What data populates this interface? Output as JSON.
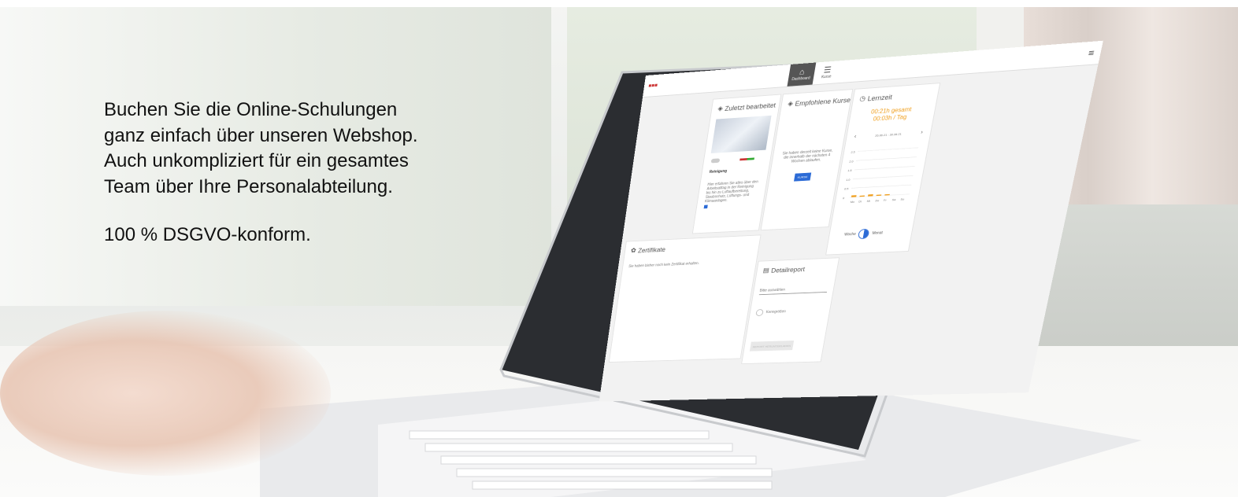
{
  "headline": {
    "lines": [
      "Buchen Sie die Online-Schulungen",
      "ganz einfach über unseren Webshop.",
      "Auch unkompliziert für ein gesamtes",
      "Team über Ihre Personalabteilung."
    ],
    "claim": "100 % DSGVO-konform."
  },
  "app": {
    "nav": [
      {
        "label": "Dashboard",
        "icon": "home-icon",
        "active": true
      },
      {
        "label": "Kurse",
        "icon": "courses-icon",
        "active": false
      }
    ],
    "menu_icon": "hamburger-icon",
    "recent": {
      "title": "Zuletzt bearbeitet",
      "course_name": "Reinigung",
      "description": "Hier erfahren Sie alles über den Arbeitsalltag in der Reinigung bis hin zu Luftaufbereitung, Staubschutz, Lüftungs- und Klimaanlagen."
    },
    "recommended": {
      "title": "Empfohlene Kurse",
      "message": "Sie haben derzeit keine Kurse, die innerhalb der nächsten 4 Wochen ablaufen.",
      "button": "KURSE"
    },
    "learning_time": {
      "title": "Lernzeit",
      "total": "00:21h gesamt",
      "per_day": "00:03h / Tag",
      "date_range": "26.06.21 - 30.06.21",
      "prev": "‹",
      "next": "›",
      "toggle_left": "Woche",
      "toggle_right": "Monat"
    },
    "certificates": {
      "title": "Zertifikate",
      "message": "Sie haben bisher noch kein Zertifikat erhalten."
    },
    "report": {
      "title": "Detailreport",
      "select_placeholder": "Bitte auswählen",
      "radio_label": "Kenngrößen",
      "button": "REPORT HERUNTERLADEN"
    }
  },
  "chart_data": {
    "type": "bar",
    "categories": [
      "Mo",
      "Di",
      "Mi",
      "Do",
      "Fr",
      "Sa",
      "So"
    ],
    "values": [
      0.1,
      0.05,
      0.1,
      0.03,
      0.05,
      0,
      0
    ],
    "yticks": [
      "0",
      "0.5",
      "1.0",
      "1.5",
      "2.0",
      "2.5"
    ],
    "ylim": [
      0,
      2.5
    ],
    "bar_color": "#f0a020"
  }
}
